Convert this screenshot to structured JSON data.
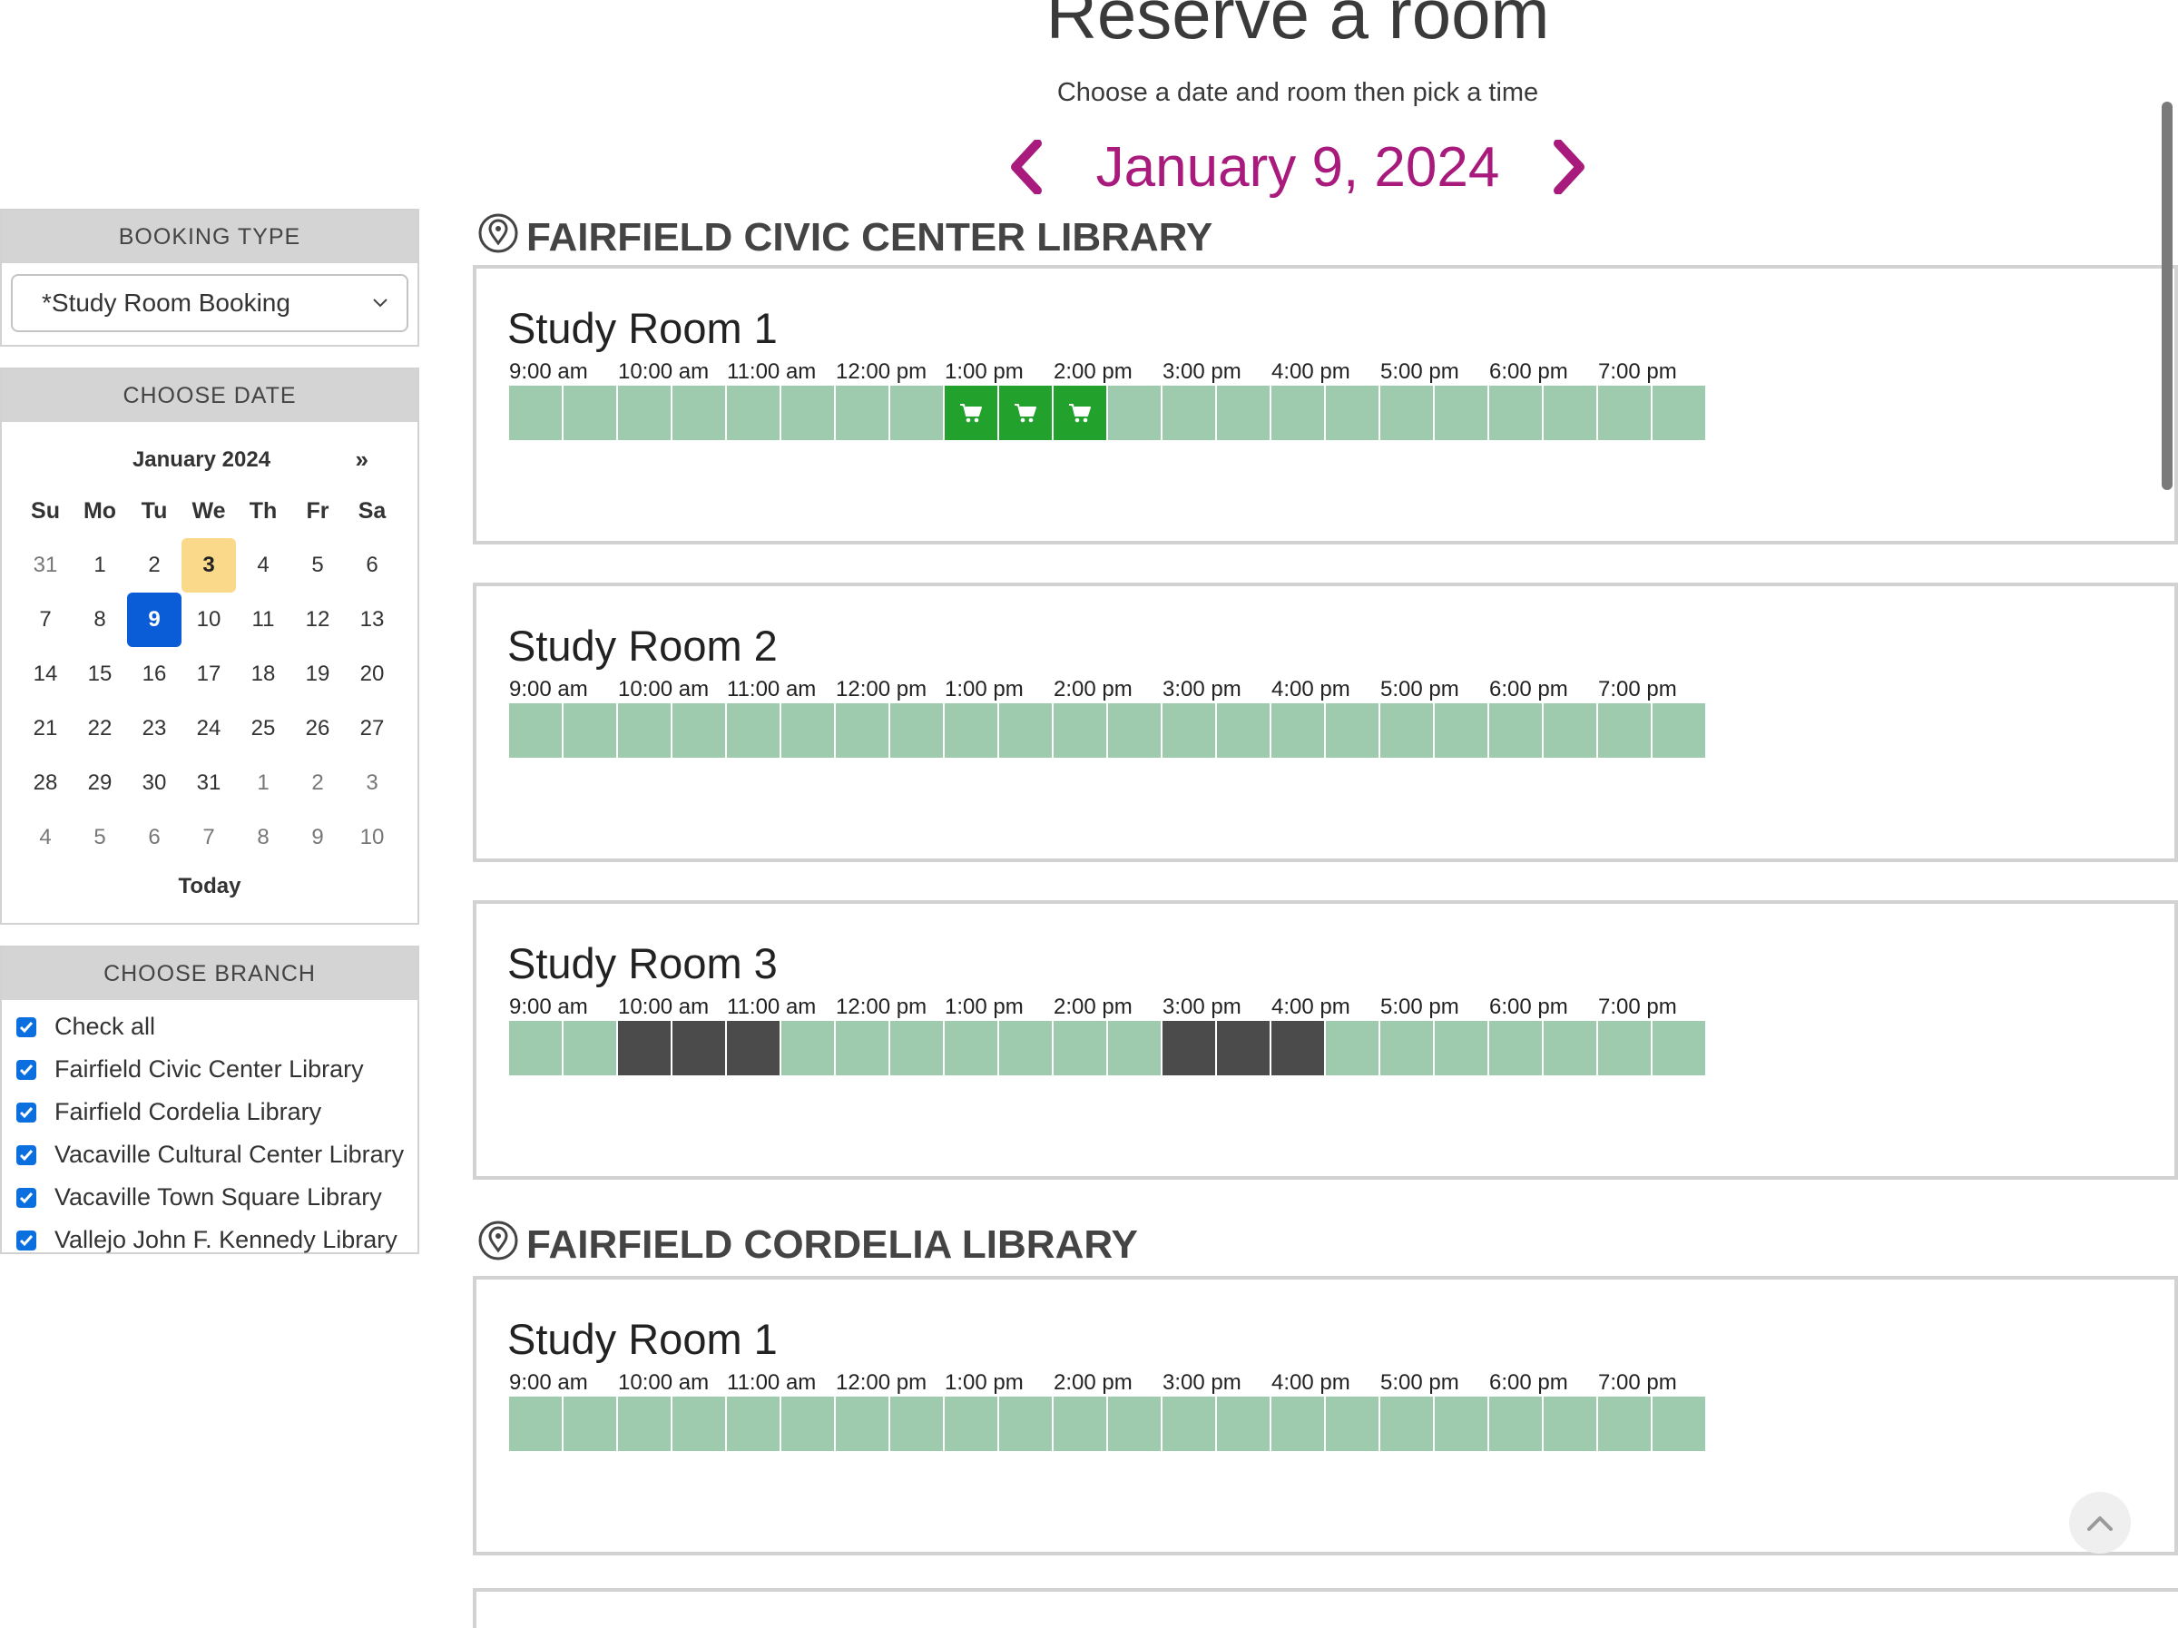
{
  "header": {
    "title": "Reserve a room",
    "subtitle": "Choose a date and room then pick a time",
    "current_date": "January 9, 2024"
  },
  "sidebar": {
    "booking_type": {
      "heading": "BOOKING TYPE",
      "selected": "*Study Room Booking"
    },
    "choose_date": {
      "heading": "CHOOSE DATE",
      "month": "January 2024",
      "next": "»",
      "weekdays": [
        "Su",
        "Mo",
        "Tu",
        "We",
        "Th",
        "Fr",
        "Sa"
      ],
      "weeks": [
        [
          "31",
          "1",
          "2",
          "3",
          "4",
          "5",
          "6"
        ],
        [
          "7",
          "8",
          "9",
          "10",
          "11",
          "12",
          "13"
        ],
        [
          "14",
          "15",
          "16",
          "17",
          "18",
          "19",
          "20"
        ],
        [
          "21",
          "22",
          "23",
          "24",
          "25",
          "26",
          "27"
        ],
        [
          "28",
          "29",
          "30",
          "31",
          "1",
          "2",
          "3"
        ],
        [
          "4",
          "5",
          "6",
          "7",
          "8",
          "9",
          "10"
        ]
      ],
      "today_day": "3",
      "selected_day": "9",
      "today_label": "Today"
    },
    "choose_branch": {
      "heading": "CHOOSE BRANCH",
      "items": [
        {
          "label": "Check all",
          "checked": true
        },
        {
          "label": "Fairfield Civic Center Library",
          "checked": true
        },
        {
          "label": "Fairfield Cordelia Library",
          "checked": true
        },
        {
          "label": "Vacaville Cultural Center Library",
          "checked": true
        },
        {
          "label": "Vacaville Town Square Library",
          "checked": true
        },
        {
          "label": "Vallejo John F. Kennedy Library",
          "checked": true
        }
      ]
    }
  },
  "times": [
    "9:00 am",
    "10:00 am",
    "11:00 am",
    "12:00 pm",
    "1:00 pm",
    "2:00 pm",
    "3:00 pm",
    "4:00 pm",
    "5:00 pm",
    "6:00 pm",
    "7:00 pm"
  ],
  "slot_legend": {
    "available": "#9ecbae",
    "in_cart": "#22a22d",
    "booked": "#4b4b4b"
  },
  "branches": [
    {
      "name": "FAIRFIELD CIVIC CENTER LIBRARY",
      "rooms": [
        {
          "name": "Study Room 1",
          "slots": [
            "a",
            "a",
            "a",
            "a",
            "a",
            "a",
            "a",
            "a",
            "c",
            "c",
            "c",
            "a",
            "a",
            "a",
            "a",
            "a",
            "a",
            "a",
            "a",
            "a",
            "a",
            "a"
          ]
        },
        {
          "name": "Study Room 2",
          "slots": [
            "a",
            "a",
            "a",
            "a",
            "a",
            "a",
            "a",
            "a",
            "a",
            "a",
            "a",
            "a",
            "a",
            "a",
            "a",
            "a",
            "a",
            "a",
            "a",
            "a",
            "a",
            "a"
          ]
        },
        {
          "name": "Study Room 3",
          "slots": [
            "a",
            "a",
            "b",
            "b",
            "b",
            "a",
            "a",
            "a",
            "a",
            "a",
            "a",
            "a",
            "b",
            "b",
            "b",
            "a",
            "a",
            "a",
            "a",
            "a",
            "a",
            "a"
          ]
        }
      ]
    },
    {
      "name": "FAIRFIELD CORDELIA LIBRARY",
      "rooms": [
        {
          "name": "Study Room 1",
          "slots": [
            "a",
            "a",
            "a",
            "a",
            "a",
            "a",
            "a",
            "a",
            "a",
            "a",
            "a",
            "a",
            "a",
            "a",
            "a",
            "a",
            "a",
            "a",
            "a",
            "a",
            "a",
            "a"
          ]
        }
      ]
    }
  ]
}
